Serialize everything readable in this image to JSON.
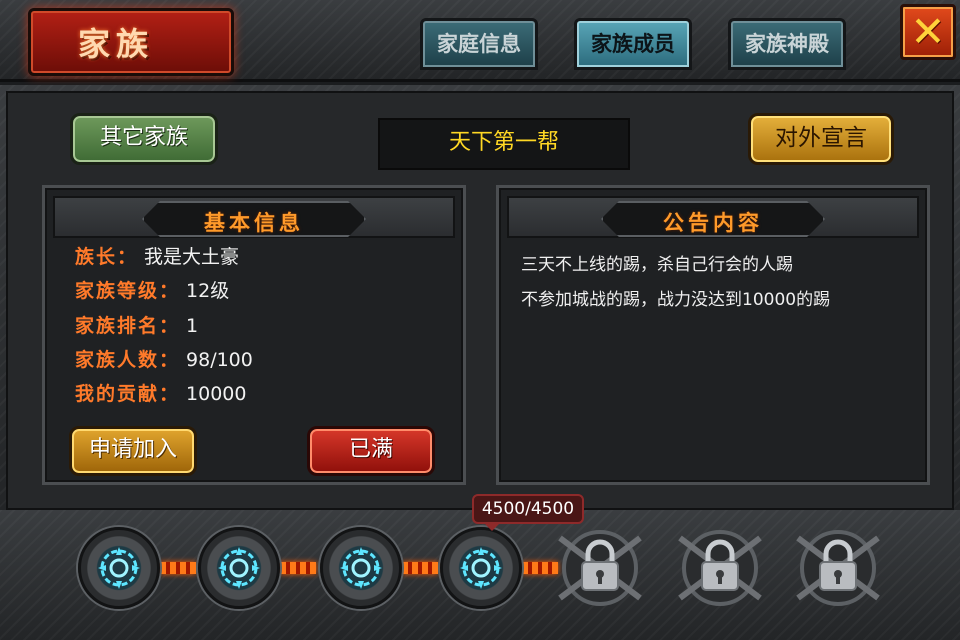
{
  "header": {
    "title": "家族",
    "tabs": [
      {
        "label": "家庭信息",
        "active": false
      },
      {
        "label": "家族成员",
        "active": true
      },
      {
        "label": "家族神殿",
        "active": false
      }
    ],
    "close_glyph": "✕"
  },
  "main": {
    "other_families_label": "其它家族",
    "family_name": "天下第一帮",
    "declare_label": "对外宣言"
  },
  "basic_info": {
    "header": "基本信息",
    "rows": [
      {
        "label": "族长：",
        "value": "我是大土豪"
      },
      {
        "label": "家族等级：",
        "value": "12级"
      },
      {
        "label": "家族排名：",
        "value": "1"
      },
      {
        "label": "家族人数：",
        "value": "98/100"
      },
      {
        "label": "我的贡献：",
        "value": "10000"
      }
    ],
    "apply_label": "申请加入",
    "full_label": "已满"
  },
  "notice": {
    "header": "公告内容",
    "lines": [
      "三天不上线的踢，杀自己行会的人踢",
      "不参加城战的踢，战力没达到10000的踢"
    ]
  },
  "progress": {
    "badge": "4500/4500",
    "unlocked_count": 4,
    "locked_count": 3,
    "node_icon": "rune-icon",
    "lock_icon": "padlock-icon"
  },
  "colors": {
    "accent_orange": "#ff7a2a",
    "name_yellow": "#ffd824",
    "title_red": "#b32015",
    "tab_teal": "#5aa6b8"
  }
}
